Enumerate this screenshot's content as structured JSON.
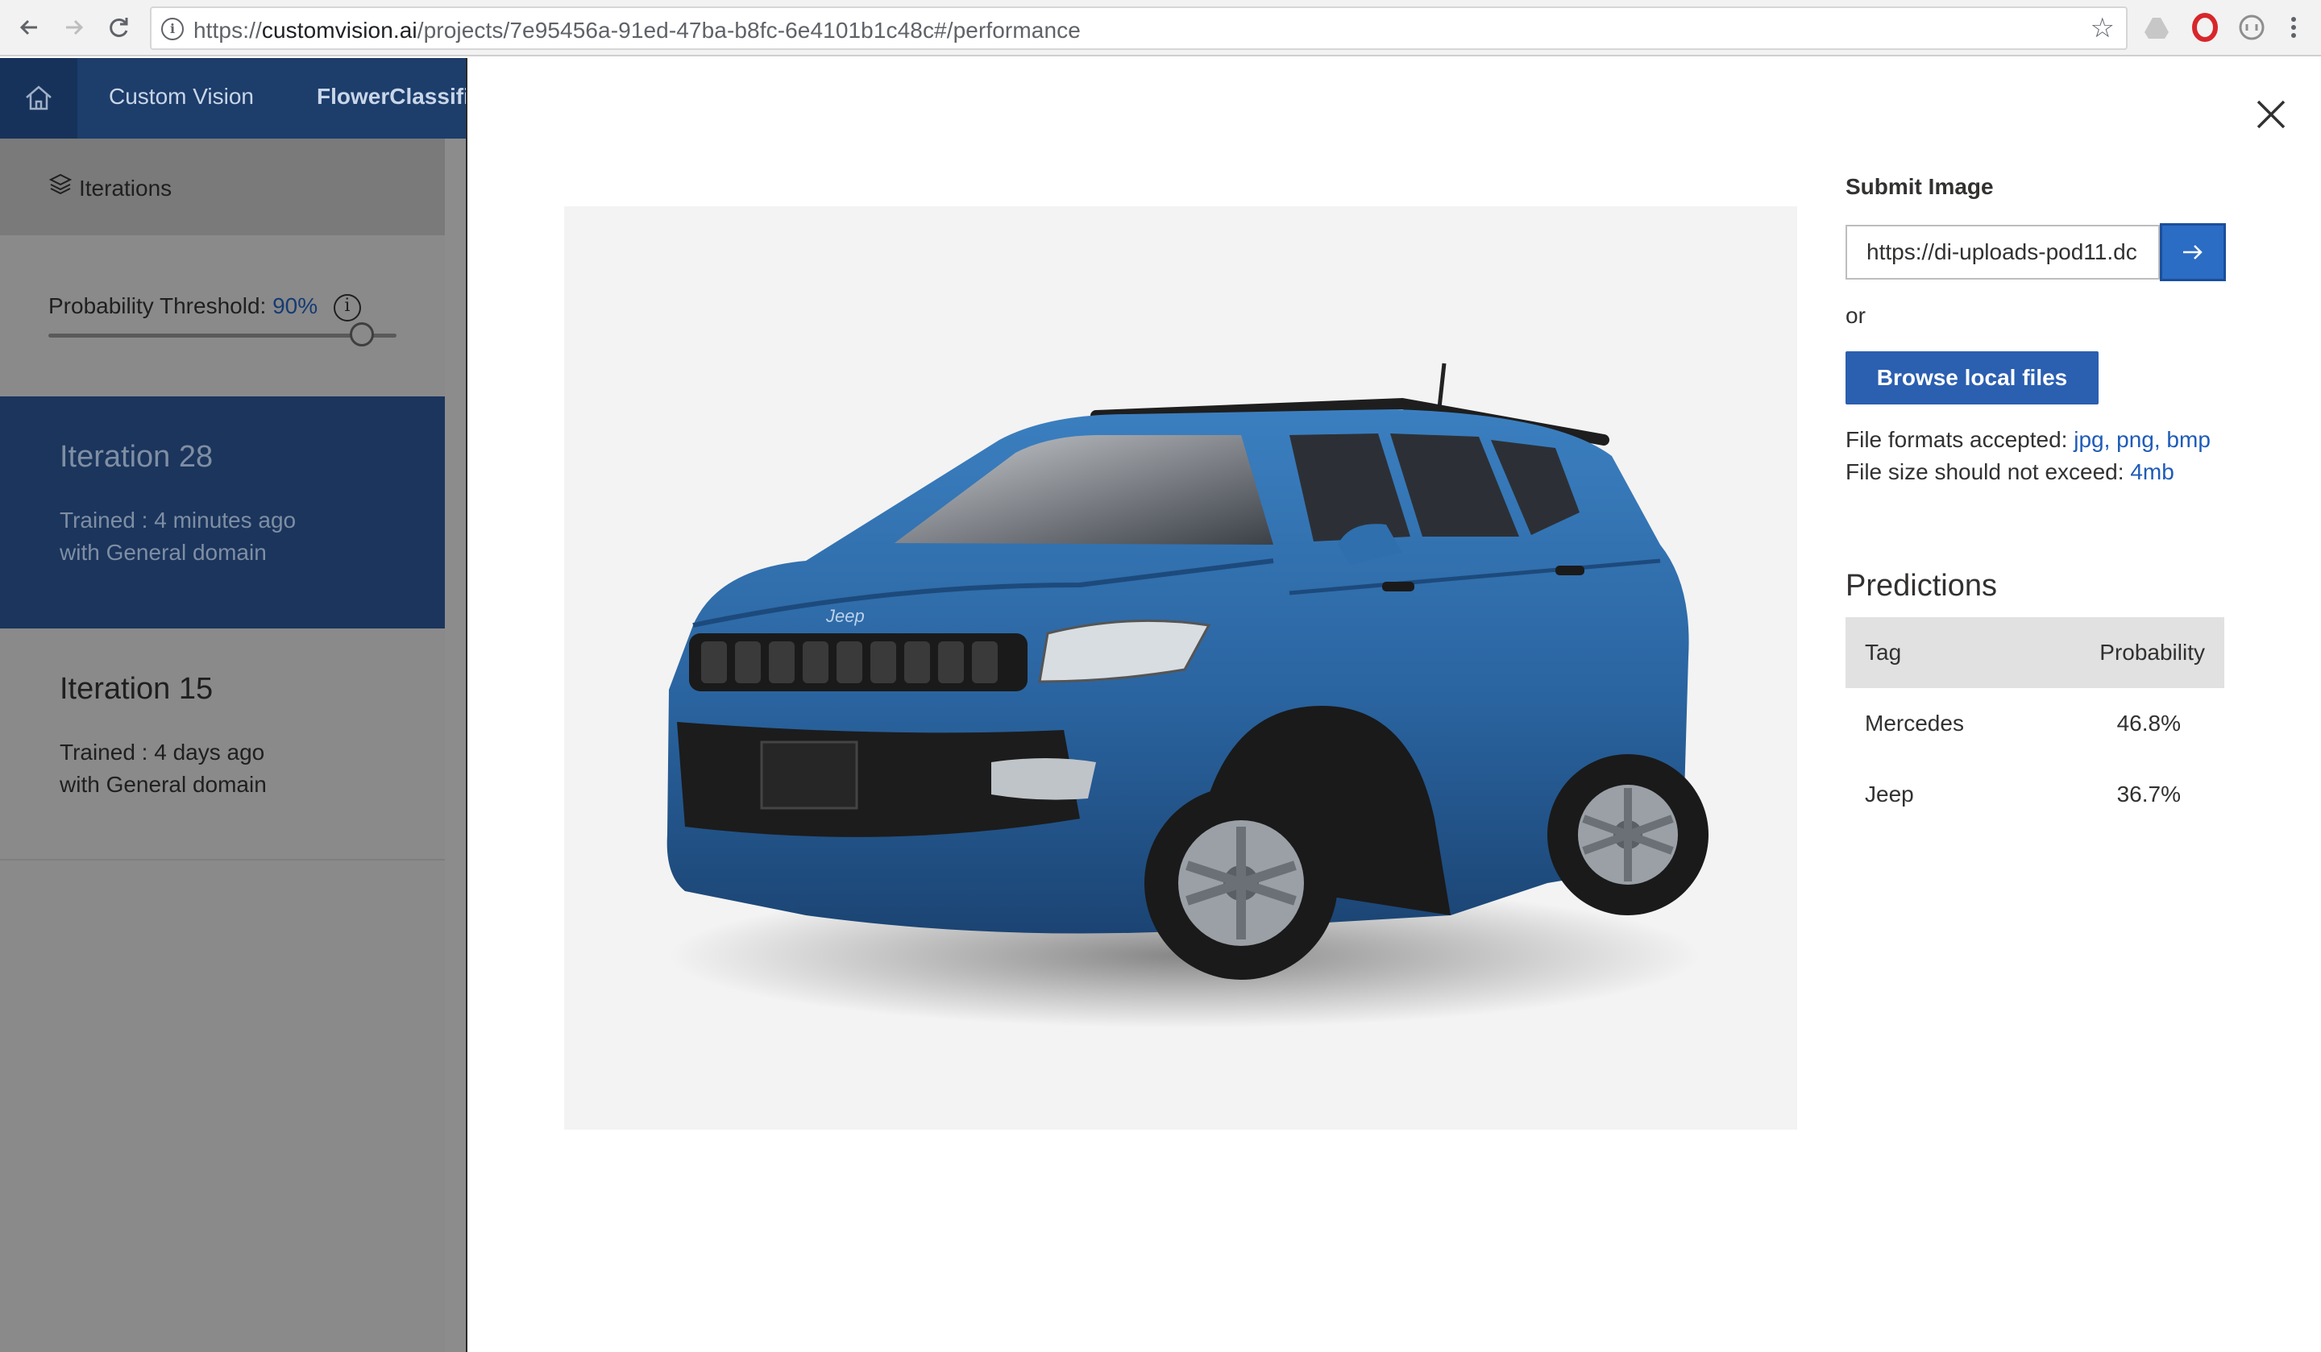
{
  "browser": {
    "url_prefix": "https://",
    "url_domain": "customvision.ai",
    "url_path": "/projects/7e95456a-91ed-47ba-b8fc-6e4101b1c48c#/performance",
    "icons": [
      "back-arrow-icon",
      "forward-arrow-icon",
      "reload-icon",
      "info-icon",
      "star-icon",
      "drive-icon",
      "opera-icon",
      "vpn-icon",
      "menu-dots-icon"
    ]
  },
  "app": {
    "brand": "Custom Vision",
    "project": "FlowerClassifi"
  },
  "sidebar": {
    "iterations_tab": "Iterations",
    "threshold_label": "Probability Threshold:",
    "threshold_value": "90%",
    "threshold_fraction": 0.9,
    "threshold_info": "i",
    "iterations": [
      {
        "title": "Iteration 28",
        "trained": "Trained : 4 minutes ago",
        "domain": "with General domain",
        "active": true
      },
      {
        "title": "Iteration 15",
        "trained": "Trained : 4 days ago",
        "domain": "with General domain",
        "active": false
      }
    ]
  },
  "modal": {
    "submit_title": "Submit Image",
    "url_value": "https://di-uploads-pod11.dc",
    "or_label": "or",
    "browse_label": "Browse local files",
    "formats_label": "File formats accepted:",
    "formats_value": "jpg, png, bmp",
    "size_label": "File size should not exceed:",
    "size_value": "4mb",
    "predictions_title": "Predictions",
    "table_headers": {
      "tag": "Tag",
      "probability": "Probability"
    },
    "predictions": [
      {
        "tag": "Mercedes",
        "probability": "46.8%"
      },
      {
        "tag": "Jeep",
        "probability": "36.7%"
      }
    ],
    "car_badge": "Jeep",
    "colors": {
      "accent": "#2b5fb0",
      "car_body": "#2a64a0",
      "header": "#1d3d6b"
    }
  }
}
